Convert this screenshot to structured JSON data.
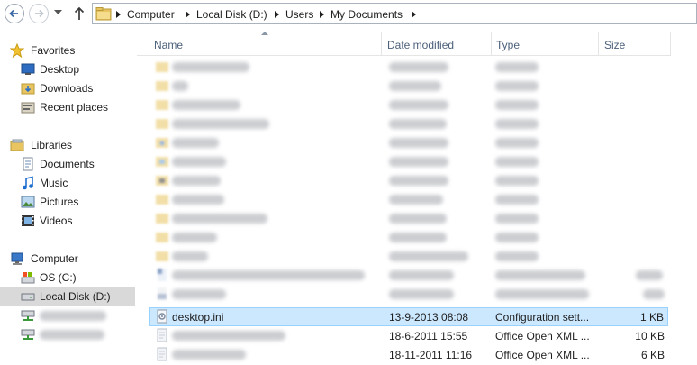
{
  "address": {
    "crumbs": [
      "Computer",
      "Local Disk (D:)",
      "Users",
      "My Documents"
    ]
  },
  "nav": {
    "favorites": {
      "label": "Favorites",
      "items": [
        {
          "label": "Desktop",
          "icon": "desktop-icon"
        },
        {
          "label": "Downloads",
          "icon": "downloads-folder-icon"
        },
        {
          "label": "Recent places",
          "icon": "recent-places-icon"
        }
      ]
    },
    "libraries": {
      "label": "Libraries",
      "items": [
        {
          "label": "Documents",
          "icon": "documents-library-icon"
        },
        {
          "label": "Music",
          "icon": "music-icon"
        },
        {
          "label": "Pictures",
          "icon": "pictures-icon"
        },
        {
          "label": "Videos",
          "icon": "videos-icon"
        }
      ]
    },
    "computer": {
      "label": "Computer",
      "items": [
        {
          "label": "OS (C:)",
          "icon": "os-drive-icon"
        },
        {
          "label": "Local Disk (D:)",
          "icon": "hard-drive-icon",
          "selected": true
        }
      ]
    }
  },
  "columns": {
    "name": "Name",
    "date": "Date modified",
    "type": "Type",
    "size": "Size"
  },
  "files": {
    "desktop_ini": {
      "name": "desktop.ini",
      "date": "13-9-2013 08:08",
      "type": "Configuration sett...",
      "size": "1 KB"
    },
    "file_b": {
      "date": "18-6-2011 15:55",
      "type": "Office Open XML ...",
      "size": "10 KB"
    },
    "file_c": {
      "date": "18-11-2011 11:16",
      "type": "Office Open XML ...",
      "size": "6 KB"
    }
  },
  "colors": {
    "selection_bg": "#cce8ff",
    "selection_border": "#99d1ff",
    "header_text": "#4c607a",
    "folder": "#e8c560"
  }
}
